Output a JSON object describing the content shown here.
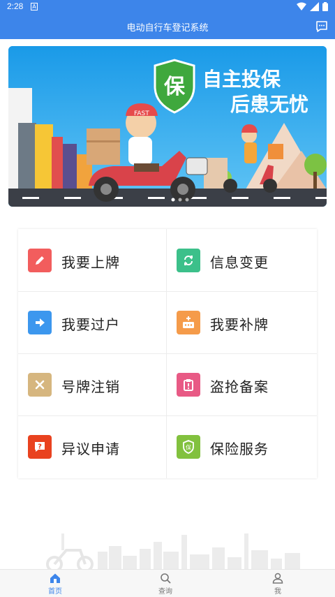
{
  "status_bar": {
    "time": "2:28",
    "notification_icon": "A"
  },
  "header": {
    "title": "电动自行车登记系统",
    "chat_icon": "message-icon"
  },
  "banner": {
    "line1": "自主投保",
    "line2": "后患无忧",
    "shield_char": "保",
    "helmet_text": "FAST"
  },
  "services": [
    {
      "label": "我要上牌",
      "icon": "pencil-icon",
      "color": "#f25d5d"
    },
    {
      "label": "信息变更",
      "icon": "refresh-icon",
      "color": "#3cc08a"
    },
    {
      "label": "我要过户",
      "icon": "arrow-right-icon",
      "color": "#3c97ee"
    },
    {
      "label": "我要补牌",
      "icon": "plate-plus-icon",
      "color": "#f59b4a"
    },
    {
      "label": "号牌注销",
      "icon": "cross-icon",
      "color": "#d6b67f"
    },
    {
      "label": "盗抢备案",
      "icon": "clipboard-alert-icon",
      "color": "#e85a85"
    },
    {
      "label": "异议申请",
      "icon": "chat-question-icon",
      "color": "#e9421f"
    },
    {
      "label": "保险服务",
      "icon": "shield-icon",
      "color": "#82c13e"
    }
  ],
  "bottom_nav": [
    {
      "label": "首页",
      "icon": "home-icon",
      "active": true
    },
    {
      "label": "查询",
      "icon": "search-icon",
      "active": false
    },
    {
      "label": "我",
      "icon": "user-icon",
      "active": false
    }
  ],
  "colors": {
    "primary": "#3d85ea",
    "nav_active": "#3d85ea",
    "nav_inactive": "#777777"
  }
}
